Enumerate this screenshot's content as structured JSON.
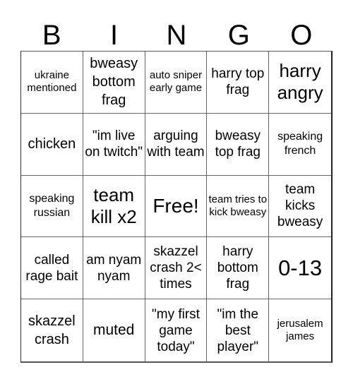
{
  "title_letters": [
    "B",
    "I",
    "N",
    "G",
    "O"
  ],
  "cells": [
    {
      "text": "ukraine mentioned"
    },
    {
      "text": "bweasy bottom frag"
    },
    {
      "text": "auto sniper early game"
    },
    {
      "text": "harry top frag"
    },
    {
      "text": "harry angry"
    },
    {
      "text": "chicken"
    },
    {
      "text": "\"im live on twitch\""
    },
    {
      "text": "arguing with team"
    },
    {
      "text": "bweasy top frag"
    },
    {
      "text": "speaking french"
    },
    {
      "text": "speaking russian"
    },
    {
      "text": "team kill x2"
    },
    {
      "text": "Free!"
    },
    {
      "text": "team tries to kick bweasy"
    },
    {
      "text": "team kicks bweasy"
    },
    {
      "text": "called rage bait"
    },
    {
      "text": "am nyam nyam"
    },
    {
      "text": "skazzel crash 2< times"
    },
    {
      "text": "harry bottom frag"
    },
    {
      "text": "0-13"
    },
    {
      "text": "skazzel crash"
    },
    {
      "text": "muted"
    },
    {
      "text": "\"my first game today\""
    },
    {
      "text": "\"im the best player\""
    },
    {
      "text": "jerusalem james"
    }
  ],
  "free_space_index": 12
}
